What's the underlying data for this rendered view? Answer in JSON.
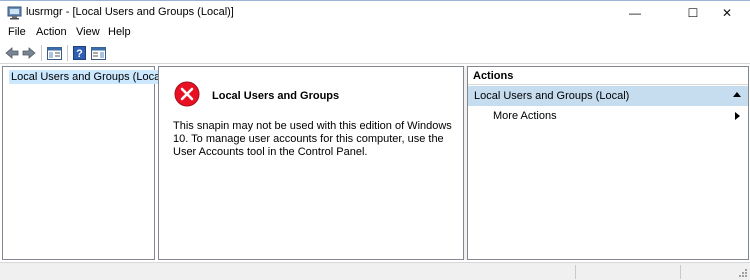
{
  "window": {
    "title": "lusrmgr - [Local Users and Groups (Local)]",
    "minimize_glyph": "—",
    "maximize_glyph": "☐",
    "close_glyph": "✕"
  },
  "menu": [
    "File",
    "Action",
    "View",
    "Help"
  ],
  "toolbar": {
    "buttons": [
      "back-arrow-icon",
      "forward-arrow-icon",
      "show-hide-console-tree-icon",
      "help-icon",
      "show-hide-action-pane-icon"
    ]
  },
  "tree": {
    "root_label": "Local Users and Groups (Local)"
  },
  "main": {
    "error_title": "Local Users and Groups",
    "error_message": "This snapin may not be used with this edition of Windows 10. To manage user accounts for this computer, use the User Accounts tool in the Control Panel."
  },
  "actions": {
    "header": "Actions",
    "group_label": "Local Users and Groups (Local)",
    "more_actions": "More Actions"
  },
  "colors": {
    "selection": "#cce8ff",
    "action_group_bg": "#c6dcef",
    "error_red": "#e81123"
  }
}
